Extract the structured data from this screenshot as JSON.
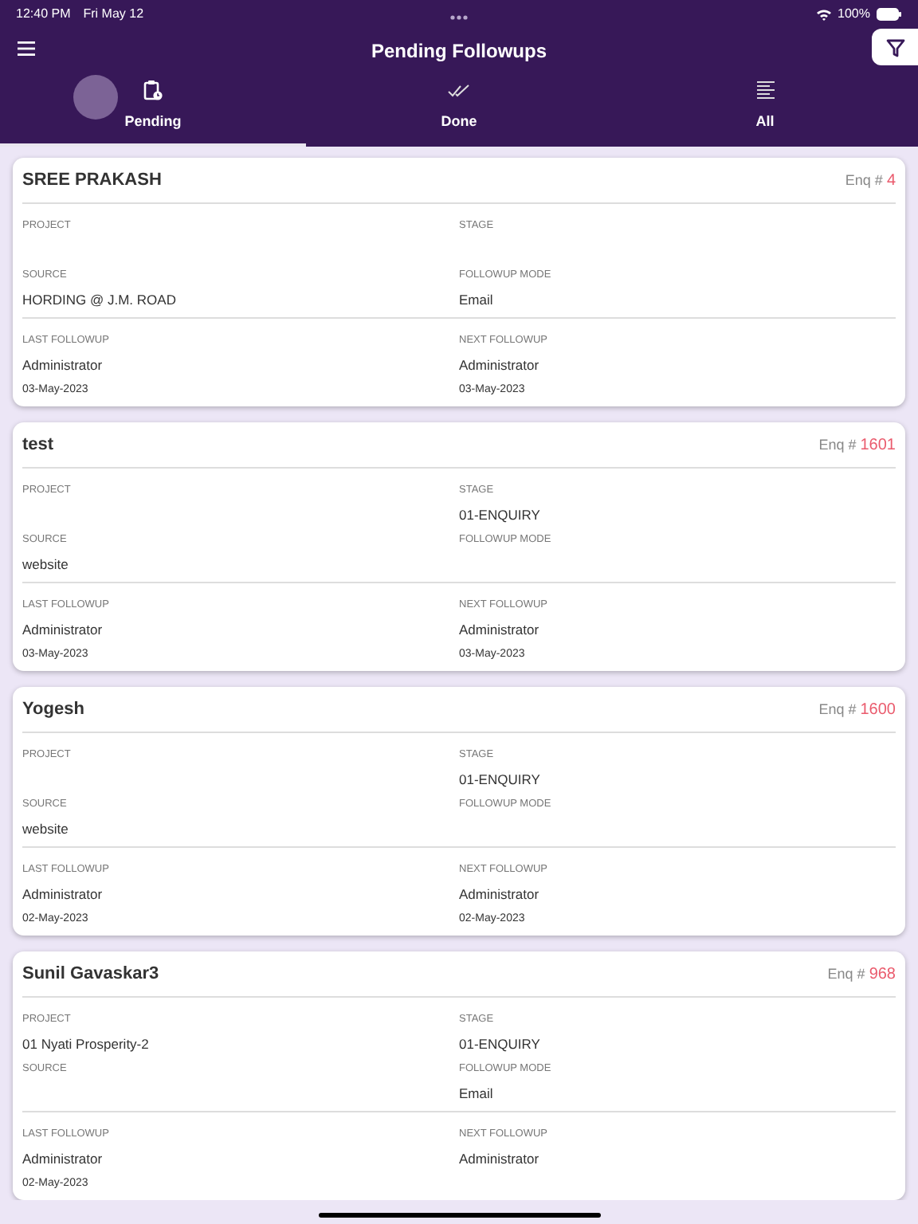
{
  "status_bar": {
    "time": "12:40 PM",
    "date": "Fri May 12",
    "battery": "100%"
  },
  "header": {
    "title": "Pending  Followups"
  },
  "tabs": [
    {
      "label": "Pending",
      "kind": "pending",
      "selected": true
    },
    {
      "label": "Done",
      "kind": "done",
      "selected": false
    },
    {
      "label": "All",
      "kind": "all",
      "selected": false
    }
  ],
  "followups": [
    {
      "name": "SREE PRAKASH",
      "enq_label": "Enq #",
      "enq_no": "4",
      "labels": {
        "project": "PROJECT",
        "stage": "STAGE",
        "source": "SOURCE",
        "followup_mode": "FOLLOWUP MODE",
        "last_followup": "LAST FOLLOWUP",
        "next_followup": "NEXT FOLLOWUP"
      },
      "source": "HORDING @ J.M. ROAD",
      "followup_mode": "Email",
      "last_by": "Administrator",
      "last_date": "03-May-2023",
      "next_by": "Administrator",
      "next_date": "03-May-2023"
    },
    {
      "name": "test",
      "enq_label": "Enq #",
      "enq_no": "1601",
      "labels": {
        "project": "PROJECT",
        "stage": "STAGE",
        "source": "SOURCE",
        "followup_mode": "FOLLOWUP MODE",
        "last_followup": "LAST FOLLOWUP",
        "next_followup": "NEXT FOLLOWUP"
      },
      "stage": "01-ENQUIRY",
      "source": "website",
      "last_by": "Administrator",
      "last_date": "03-May-2023",
      "next_by": "Administrator",
      "next_date": "03-May-2023"
    },
    {
      "name": "Yogesh",
      "enq_label": "Enq #",
      "enq_no": "1600",
      "labels": {
        "project": "PROJECT",
        "stage": "STAGE",
        "source": "SOURCE",
        "followup_mode": "FOLLOWUP MODE",
        "last_followup": "LAST FOLLOWUP",
        "next_followup": "NEXT FOLLOWUP"
      },
      "stage": "01-ENQUIRY",
      "source": "website",
      "last_by": "Administrator",
      "last_date": "02-May-2023",
      "next_by": "Administrator",
      "next_date": "02-May-2023"
    },
    {
      "name": "Sunil Gavaskar3",
      "enq_label": "Enq #",
      "enq_no": "968",
      "labels": {
        "project": "PROJECT",
        "stage": "STAGE",
        "source": "SOURCE",
        "followup_mode": "FOLLOWUP MODE",
        "last_followup": "LAST FOLLOWUP",
        "next_followup": "NEXT FOLLOWUP"
      },
      "project": "01 Nyati Prosperity-2",
      "stage": "01-ENQUIRY",
      "followup_mode": "Email",
      "last_by": "Administrator",
      "last_date": "02-May-2023",
      "next_by": "Administrator"
    }
  ]
}
